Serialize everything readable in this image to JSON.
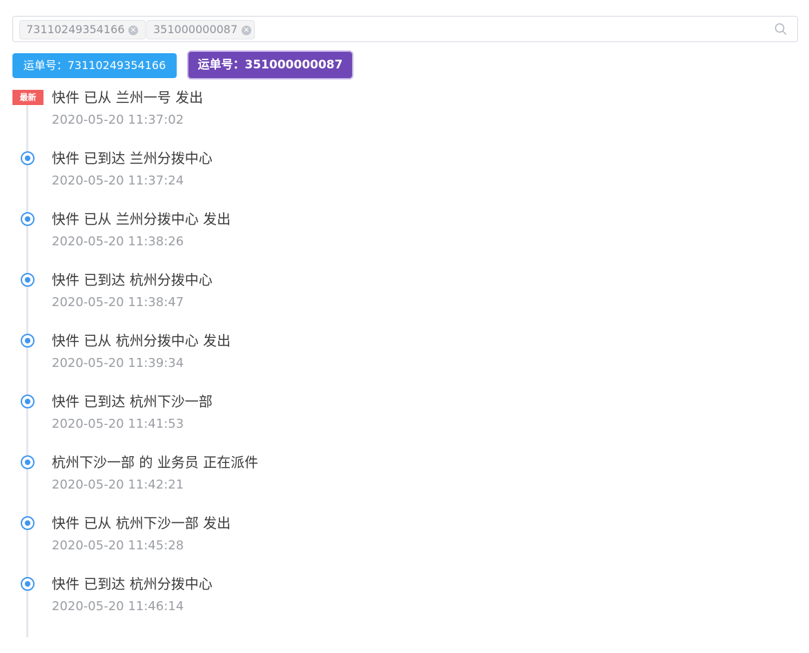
{
  "search": {
    "tags": [
      {
        "label": "73110249354166"
      },
      {
        "label": "351000000087"
      }
    ],
    "close_glyph": "✕",
    "icon": "search-icon"
  },
  "waybills": [
    {
      "label": "运单号：73110249354166",
      "active": false,
      "color": "#2fa4f3"
    },
    {
      "label": "运单号：351000000087",
      "active": true,
      "color": "#6f47b6"
    }
  ],
  "timeline": {
    "latest_badge": "最新",
    "accent_color": "#4096f0",
    "events": [
      {
        "text": "快件 已从 兰州一号 发出",
        "time": "2020-05-20 11:37:02"
      },
      {
        "text": "快件 已到达 兰州分拨中心",
        "time": "2020-05-20 11:37:24"
      },
      {
        "text": "快件 已从 兰州分拨中心 发出",
        "time": "2020-05-20 11:38:26"
      },
      {
        "text": "快件 已到达 杭州分拨中心",
        "time": "2020-05-20 11:38:47"
      },
      {
        "text": "快件 已从 杭州分拨中心 发出",
        "time": "2020-05-20 11:39:34"
      },
      {
        "text": "快件 已到达 杭州下沙一部",
        "time": "2020-05-20 11:41:53"
      },
      {
        "text": "杭州下沙一部 的 业务员 正在派件",
        "time": "2020-05-20 11:42:21"
      },
      {
        "text": "快件 已从 杭州下沙一部 发出",
        "time": "2020-05-20 11:45:28"
      },
      {
        "text": "快件 已到达 杭州分拨中心",
        "time": "2020-05-20 11:46:14"
      }
    ]
  }
}
